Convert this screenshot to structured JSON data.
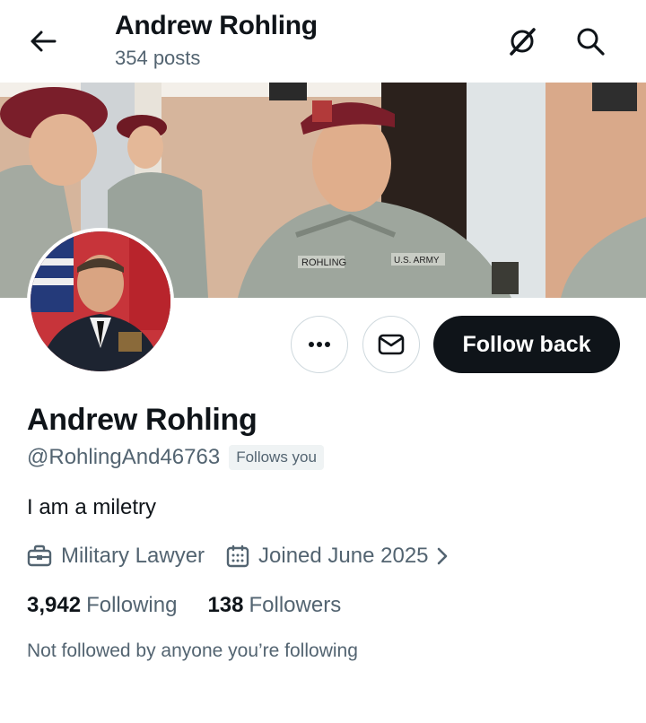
{
  "header": {
    "back_icon": "arrow-left-icon",
    "name": "Andrew Rohling",
    "posts": "354 posts",
    "grok_icon": "grok-icon",
    "search_icon": "search-icon"
  },
  "banner": {
    "description_colors": {
      "wall": "#d8b79e",
      "beret": "#7a1e2a",
      "camo": "#9aa39b"
    },
    "name_tape": "ROHLING",
    "branch_tape": "U.S. ARMY"
  },
  "avatar": {
    "background": "#1a2234"
  },
  "actions": {
    "more_icon": "more-dots-icon",
    "message_icon": "envelope-icon",
    "follow_back_label": "Follow back"
  },
  "profile": {
    "display_name": "Andrew Rohling",
    "handle": "@RohlingAnd46763",
    "follows_you_badge": "Follows you",
    "bio": "I am a miletry",
    "profession": "Military Lawyer",
    "profession_icon": "briefcase-icon",
    "joined": "Joined June 2025",
    "joined_icon": "calendar-icon",
    "following_count": "3,942",
    "following_label": "Following",
    "followers_count": "138",
    "followers_label": "Followers",
    "not_followed_text": "Not followed by anyone you’re following"
  }
}
